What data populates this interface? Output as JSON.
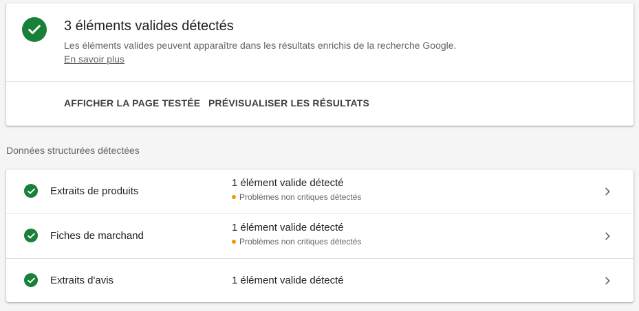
{
  "summary": {
    "title": "3 éléments valides détectés",
    "description": "Les éléments valides peuvent apparaître dans les résultats enrichis de la recherche Google.",
    "learn_more": "En savoir plus",
    "actions": {
      "view_page": "AFFICHER LA PAGE TESTÉE",
      "preview": "PRÉVISUALISER LES RÉSULTATS"
    }
  },
  "section_label": "Données structurées détectées",
  "items": [
    {
      "name": "Extraits de produits",
      "status": "1 élément valide détecté",
      "warning": "Problèmes non critiques détectés"
    },
    {
      "name": "Fiches de marchand",
      "status": "1 élément valide détecté",
      "warning": "Problèmes non critiques détectés"
    },
    {
      "name": "Extraits d'avis",
      "status": "1 élément valide détecté"
    }
  ],
  "colors": {
    "success": "#188038",
    "warning": "#f29900",
    "text_primary": "#202124",
    "text_secondary": "#5f6368"
  },
  "icons": {
    "summary": "check-circle-icon",
    "item_status": "check-circle-icon",
    "item_nav": "chevron-right-icon",
    "warning": "warning-dot-icon"
  }
}
